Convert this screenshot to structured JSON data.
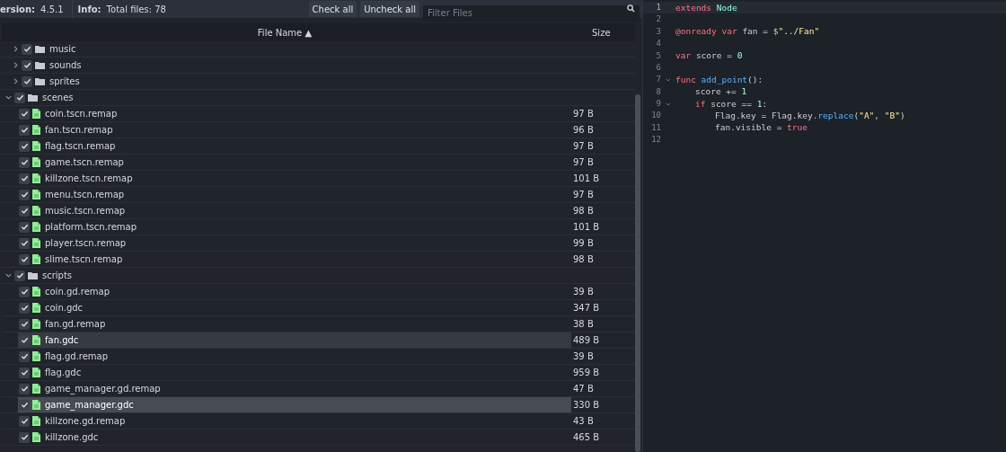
{
  "top_bar": {
    "version_label": "ersion:",
    "version": "4.5.1",
    "info_label": "Info:",
    "info": "Total files: 78",
    "buttons": [
      "Check all",
      "Uncheck all"
    ],
    "filter": {
      "placeholder": "Filter Files"
    }
  },
  "file_table": {
    "columns": [
      "File Name ▲",
      "Size"
    ],
    "orphan_children": [
      {
        "name": "music",
        "kind": "folder",
        "checked": true,
        "expanded": false
      },
      {
        "name": "sounds",
        "kind": "folder",
        "checked": true,
        "expanded": false
      },
      {
        "name": "sprites",
        "kind": "folder",
        "checked": true,
        "expanded": false
      }
    ],
    "items": [
      {
        "name": "scenes",
        "kind": "folder",
        "checked": true,
        "expanded": true,
        "children": [
          {
            "name": "coin.tscn.remap",
            "kind": "file",
            "size": "97 B",
            "checked": true,
            "selected": false,
            "hovered": false
          },
          {
            "name": "fan.tscn.remap",
            "kind": "file",
            "size": "96 B",
            "checked": true,
            "selected": false,
            "hovered": false
          },
          {
            "name": "flag.tscn.remap",
            "kind": "file",
            "size": "97 B",
            "checked": true,
            "selected": false,
            "hovered": false
          },
          {
            "name": "game.tscn.remap",
            "kind": "file",
            "size": "97 B",
            "checked": true,
            "selected": false,
            "hovered": false
          },
          {
            "name": "killzone.tscn.remap",
            "kind": "file",
            "size": "101 B",
            "checked": true,
            "selected": false,
            "hovered": false
          },
          {
            "name": "menu.tscn.remap",
            "kind": "file",
            "size": "97 B",
            "checked": true,
            "selected": false,
            "hovered": false
          },
          {
            "name": "music.tscn.remap",
            "kind": "file",
            "size": "98 B",
            "checked": true,
            "selected": false,
            "hovered": false
          },
          {
            "name": "platform.tscn.remap",
            "kind": "file",
            "size": "101 B",
            "checked": true,
            "selected": false,
            "hovered": false
          },
          {
            "name": "player.tscn.remap",
            "kind": "file",
            "size": "99 B",
            "checked": true,
            "selected": false,
            "hovered": false
          },
          {
            "name": "slime.tscn.remap",
            "kind": "file",
            "size": "98 B",
            "checked": true,
            "selected": false,
            "hovered": false
          }
        ]
      },
      {
        "name": "scripts",
        "kind": "folder",
        "checked": true,
        "expanded": true,
        "children": [
          {
            "name": "coin.gd.remap",
            "kind": "file",
            "size": "39 B",
            "checked": true,
            "selected": false,
            "hovered": false
          },
          {
            "name": "coin.gdc",
            "kind": "file",
            "size": "347 B",
            "checked": true,
            "selected": false,
            "hovered": false
          },
          {
            "name": "fan.gd.remap",
            "kind": "file",
            "size": "38 B",
            "checked": true,
            "selected": false,
            "hovered": false
          },
          {
            "name": "fan.gdc",
            "kind": "file",
            "size": "489 B",
            "checked": true,
            "selected": false,
            "hovered": true
          },
          {
            "name": "flag.gd.remap",
            "kind": "file",
            "size": "39 B",
            "checked": true,
            "selected": false,
            "hovered": false
          },
          {
            "name": "flag.gdc",
            "kind": "file",
            "size": "959 B",
            "checked": true,
            "selected": false,
            "hovered": false
          },
          {
            "name": "game_manager.gd.remap",
            "kind": "file",
            "size": "47 B",
            "checked": true,
            "selected": false,
            "hovered": false
          },
          {
            "name": "game_manager.gdc",
            "kind": "file",
            "size": "330 B",
            "checked": true,
            "selected": true,
            "hovered": false
          },
          {
            "name": "killzone.gd.remap",
            "kind": "file",
            "size": "43 B",
            "checked": true,
            "selected": false,
            "hovered": false
          },
          {
            "name": "killzone.gdc",
            "kind": "file",
            "size": "465 B",
            "checked": true,
            "selected": false,
            "hovered": false
          }
        ]
      }
    ]
  },
  "code_editor": {
    "lines": [
      {
        "number": "1",
        "current": true,
        "foldable": false,
        "tokens": [
          {
            "t": "extends",
            "kind": "keyword"
          },
          {
            "t": " Node",
            "kind": "type"
          }
        ]
      },
      {
        "number": "2",
        "current": false,
        "foldable": false
      },
      {
        "number": "3",
        "current": false,
        "foldable": false,
        "tokens": [
          {
            "t": "@onready",
            "kind": "keyword"
          },
          {
            "t": " var",
            "kind": "keyword"
          },
          {
            "t": " fan = $",
            "kind": "plain"
          },
          {
            "t": "\"../Fan\"",
            "kind": "string"
          }
        ]
      },
      {
        "number": "4",
        "current": false,
        "foldable": false
      },
      {
        "number": "5",
        "current": false,
        "foldable": false,
        "tokens": [
          {
            "t": "var",
            "kind": "keyword"
          },
          {
            "t": " score = ",
            "kind": "plain"
          },
          {
            "t": "0",
            "kind": "number"
          }
        ]
      },
      {
        "number": "6",
        "current": false,
        "foldable": false
      },
      {
        "number": "7",
        "current": false,
        "foldable": true,
        "tokens": [
          {
            "t": "func",
            "kind": "keyword"
          },
          {
            "t": " add_point",
            "kind": "func"
          },
          {
            "t": "():",
            "kind": "plain"
          }
        ],
        "children": [
          {
            "number": "8",
            "current": false,
            "foldable": false,
            "tokens": [
              {
                "t": "score += ",
                "kind": "plain"
              },
              {
                "t": "1",
                "kind": "number"
              }
            ]
          },
          {
            "number": "9",
            "current": false,
            "foldable": true,
            "tokens": [
              {
                "t": "if",
                "kind": "keyword"
              },
              {
                "t": " score == ",
                "kind": "plain"
              },
              {
                "t": "1",
                "kind": "number"
              },
              {
                "t": ":",
                "kind": "plain"
              }
            ],
            "children": [
              {
                "number": "10",
                "current": false,
                "foldable": false,
                "tokens": [
                  {
                    "t": "Flag.key = Flag.key.",
                    "kind": "plain"
                  },
                  {
                    "t": "replace",
                    "kind": "func"
                  },
                  {
                    "t": "(",
                    "kind": "plain"
                  },
                  {
                    "t": "\"A\"",
                    "kind": "string"
                  },
                  {
                    "t": ", ",
                    "kind": "plain"
                  },
                  {
                    "t": "\"B\"",
                    "kind": "string"
                  },
                  {
                    "t": ")",
                    "kind": "plain"
                  }
                ]
              },
              {
                "number": "11",
                "current": false,
                "foldable": false,
                "tokens": [
                  {
                    "t": "fan.visible = ",
                    "kind": "plain"
                  },
                  {
                    "t": "true",
                    "kind": "keyword"
                  }
                ]
              }
            ]
          }
        ]
      },
      {
        "number": "12",
        "current": false,
        "foldable": false
      }
    ]
  }
}
